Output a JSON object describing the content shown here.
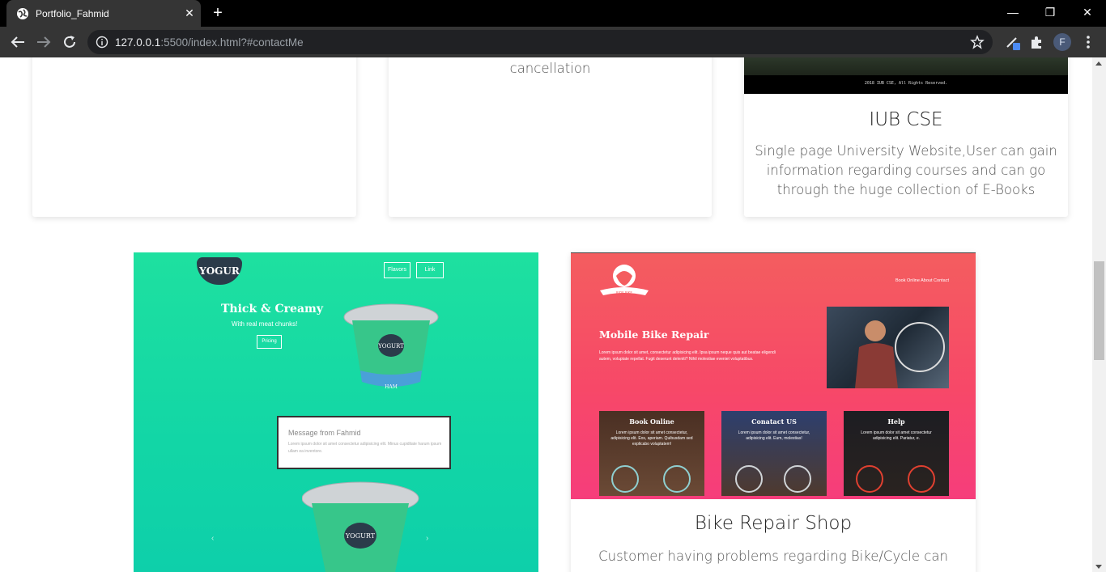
{
  "browser": {
    "tab_title": "Portfolio_Fahmid",
    "url_host": "127.0.0.1",
    "url_rest": ":5500/index.html?#contactMe",
    "profile_initial": "F"
  },
  "cards_top": [
    {
      "desc_tail": "cancellation"
    },
    {
      "title": "IUB CSE",
      "desc": [
        "Single page University Website,User can gain",
        "information regarding courses and can go",
        "through the huge collection of E-Books"
      ],
      "footer_text": "2018 IUB CSE, All Rights Reserved."
    }
  ],
  "yogurt_preview": {
    "logo": "YOGUR",
    "nav": [
      "Flavors",
      "Link"
    ],
    "heading": "Thick & Creamy",
    "subheading": "With real meat chunks!",
    "button": "Pricing",
    "cup_label": "YOGURT",
    "cup_sub": "HAM",
    "message_title": "Message from Fahmid",
    "message_body": "Lorem ipsum dolor sit amet consectetur adipisicing elit. Minus cupiditate harum ipsum ullam ea inventore."
  },
  "bike_card": {
    "title": "Bike Repair Shop",
    "desc_first_line": "Customer having problems regarding Bike/Cycle can",
    "preview": {
      "brand": "RIDE BIKE",
      "nav": "Book Online About Contact",
      "heading": "Mobile Bike Repair",
      "text": "Lorem ipsum dolor sit amet, consectetur adipisicing elit. Ipsa ipsum neque quis aut beatae eligendi autem, voluptate repellat. Fugit deserunt deleniti? Nihil molestiae eveniet voluptatibus.",
      "tiles": [
        {
          "title": "Book Online",
          "text": "Lorem ipsum dolor sit amet consectetur, adipisicing elit. Eos, aperiam. Quibusdam sed explicabo voluptatem!"
        },
        {
          "title": "Conatact US",
          "text": "Lorem ipsum dolor sit amet consectetur, adipisicing elit. Eum, molestias!"
        },
        {
          "title": "Help",
          "text": "Lorem ipsum dolor sit amet consectetur adipisicing elit. Pariatur, e."
        }
      ]
    }
  }
}
